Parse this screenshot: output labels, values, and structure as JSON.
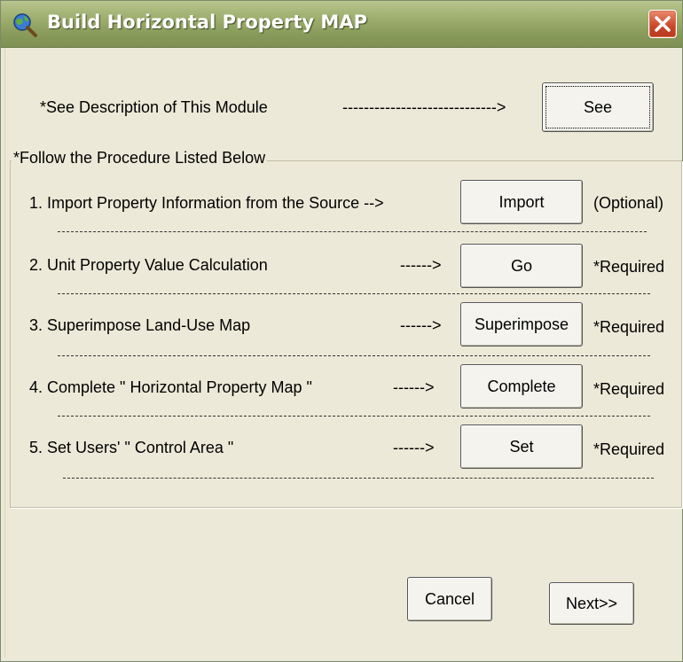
{
  "window": {
    "title": "Build Horizontal Property MAP"
  },
  "description": {
    "text": "*See Description of This Module",
    "arrow": "----------------------------->",
    "button_label": "See"
  },
  "procedure": {
    "legend": "*Follow the Procedure Listed Below",
    "steps": [
      {
        "label": "1.  Import Property Information from the Source -->",
        "arrow": "",
        "button": "Import",
        "status": "(Optional)"
      },
      {
        "label": "2.  Unit Property Value Calculation",
        "arrow": "------>",
        "button": "Go",
        "status": "*Required"
      },
      {
        "label": "3.  Superimpose Land-Use Map",
        "arrow": "------>",
        "button": "Superimpose",
        "status": "*Required"
      },
      {
        "label": "4.  Complete \" Horizontal Property Map \"",
        "arrow": "------>",
        "button": "Complete",
        "status": "*Required"
      },
      {
        "label": "5.  Set Users'  \" Control Area \"",
        "arrow": "------>",
        "button": "Set",
        "status": "*Required"
      }
    ]
  },
  "footer": {
    "cancel_label": "Cancel",
    "next_label": "Next>>"
  }
}
